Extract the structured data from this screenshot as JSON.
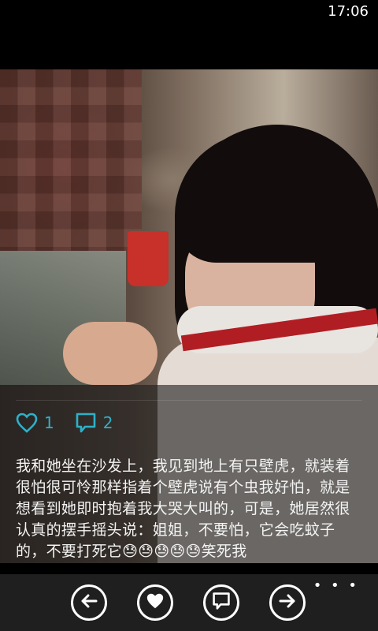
{
  "status": {
    "time": "17:06"
  },
  "post": {
    "likes": "1",
    "comments": "2",
    "text": "我和她坐在沙发上，我见到地上有只壁虎，就装着很怕很可怜那样指着个壁虎说有个虫我好怕，就是想看到她即时抱着我大哭大叫的，可是，她居然很认真的摆手摇头说：姐姐，不要怕，它会吃蚊子的，不要打死它😓😓😓😓😓笑死我"
  },
  "app_bar": {
    "buttons": [
      "back-icon",
      "heart-icon",
      "comment-icon",
      "forward-icon"
    ],
    "more": "• • •"
  },
  "colors": {
    "accent": "#2eb1c8",
    "appbar": "#1f1f1f"
  }
}
